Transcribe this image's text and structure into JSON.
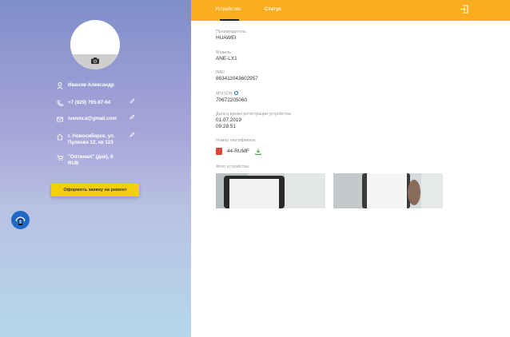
{
  "profile": {
    "name": "Иванов Александр",
    "phone": "+7 (929) 765-87-64",
    "email": "ivanov.a@gmail.com",
    "address": "г. Новосибирск, ул. Пулкова 12, кв 123",
    "shop": "\"Оптимал\" (днк), 6 RUB",
    "order_button": "Оформить заявку на ремонт"
  },
  "tabs": [
    {
      "label": "Устройство",
      "active": true
    },
    {
      "label": "Статус",
      "active": false
    }
  ],
  "device": {
    "manufacturer_label": "Производитель",
    "manufacturer": "HUAWEI",
    "model_label": "Модель",
    "model": "ANE-LX1",
    "imei_label": "IMEI",
    "imei": "863411043602957",
    "msisdn_label": "MSISDN",
    "msisdn": "70672205060",
    "reg_label": "Дата и время регистрации устройства",
    "reg_date": "01.07.2019",
    "reg_time": "09:28:51",
    "cert_label": "Номер сертификата",
    "cert": "44-RUMF",
    "photos_label": "Фото устройства"
  },
  "colors": {
    "topbar": "#f9ad1f",
    "button": "#f5cf0c",
    "support": "#1f68c6"
  },
  "icons": [
    "camera-icon",
    "user-icon",
    "phone-icon",
    "mail-icon",
    "home-icon",
    "cart-icon",
    "pencil-icon",
    "logout-icon",
    "info-icon",
    "pdf-icon",
    "download-icon",
    "support-icon"
  ]
}
